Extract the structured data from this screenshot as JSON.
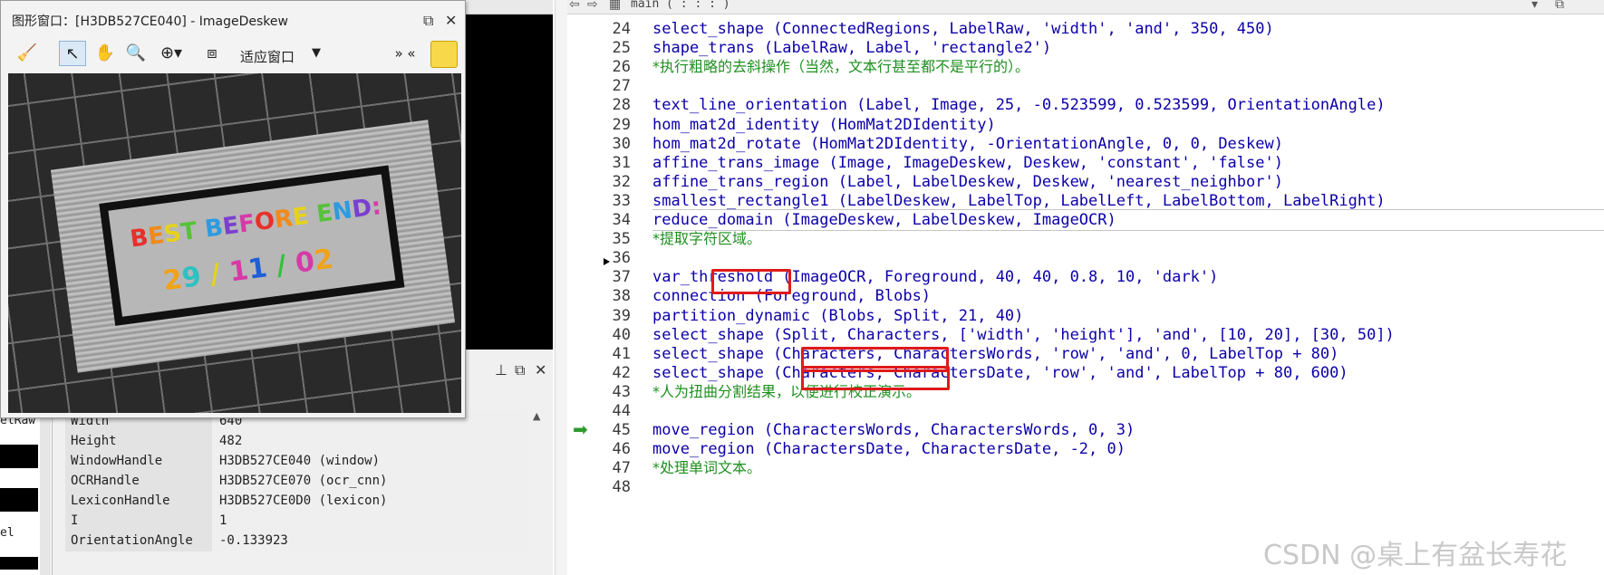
{
  "graphics_window": {
    "title": "图形窗口：[H3DB527CE040] - ImageDeskew",
    "fit_label": "适应窗口",
    "overflow_label": "» «"
  },
  "image": {
    "headline": "BEST BEFORE END:",
    "date_line": "29 / 11 / 02",
    "headline_colors": [
      "#e8302a",
      "#f08a1a",
      "#e6d21c",
      "#56c23a",
      "#2c9be0",
      "#7a3fd0",
      "#d63aa8"
    ],
    "date_colors": [
      "#f0a21a",
      "#2fc1c1",
      "#e8d21c",
      "#d63aa8",
      "#1e5ed6",
      "#2ec43a",
      "#d63aa8"
    ]
  },
  "object_strip": {
    "labels": [
      "elRaw",
      "el"
    ]
  },
  "properties": [
    {
      "key": "Width",
      "value": "640"
    },
    {
      "key": "Height",
      "value": "482"
    },
    {
      "key": "WindowHandle",
      "value": "H3DB527CE040 (window)"
    },
    {
      "key": "OCRHandle",
      "value": "H3DB527CE070 (ocr_cnn)"
    },
    {
      "key": "LexiconHandle",
      "value": "H3DB527CE0D0 (lexicon)"
    },
    {
      "key": "I",
      "value": "1"
    },
    {
      "key": "OrientationAngle",
      "value": "-0.133923"
    }
  ],
  "editor": {
    "procedure_selector": "main ( : : : )",
    "current_line": "45",
    "lines": [
      {
        "n": "24",
        "code": "select_shape (ConnectedRegions, LabelRaw, 'width', 'and', 350, 450)",
        "comment": false
      },
      {
        "n": "25",
        "code": "shape_trans (LabelRaw, Label, 'rectangle2')",
        "comment": false
      },
      {
        "n": "26",
        "code": "*执行粗略的去斜操作（当然，文本行甚至都不是平行的）。",
        "comment": true
      },
      {
        "n": "27",
        "code": "",
        "comment": false
      },
      {
        "n": "28",
        "code": "text_line_orientation (Label, Image, 25, -0.523599, 0.523599, OrientationAngle)",
        "comment": false
      },
      {
        "n": "29",
        "code": "hom_mat2d_identity (HomMat2DIdentity)",
        "comment": false
      },
      {
        "n": "30",
        "code": "hom_mat2d_rotate (HomMat2DIdentity, -OrientationAngle, 0, 0, Deskew)",
        "comment": false
      },
      {
        "n": "31",
        "code": "affine_trans_image (Image, ImageDeskew, Deskew, 'constant', 'false')",
        "comment": false
      },
      {
        "n": "32",
        "code": "affine_trans_region (Label, LabelDeskew, Deskew, 'nearest_neighbor')",
        "comment": false
      },
      {
        "n": "33",
        "code": "smallest_rectangle1 (LabelDeskew, LabelTop, LabelLeft, LabelBottom, LabelRight)",
        "comment": false
      },
      {
        "n": "34",
        "code": "reduce_domain (ImageDeskew, LabelDeskew, ImageOCR)",
        "comment": false
      },
      {
        "n": "35",
        "code": "*提取字符区域。",
        "comment": true
      },
      {
        "n": "36",
        "code": "",
        "comment": false
      },
      {
        "n": "37",
        "code": "var_threshold (ImageOCR, Foreground, 40, 40, 0.8, 10, 'dark')",
        "comment": false
      },
      {
        "n": "38",
        "code": "connection (Foreground, Blobs)",
        "comment": false
      },
      {
        "n": "39",
        "code": "partition_dynamic (Blobs, Split, 21, 40)",
        "comment": false
      },
      {
        "n": "40",
        "code": "select_shape (Split, Characters, ['width', 'height'], 'and', [10, 20], [30, 50])",
        "comment": false
      },
      {
        "n": "41",
        "code": "select_shape (Characters, CharactersWords, 'row', 'and', 0, LabelTop + 80)",
        "comment": false
      },
      {
        "n": "42",
        "code": "select_shape (Characters, CharactersDate, 'row', 'and', LabelTop + 80, 600)",
        "comment": false
      },
      {
        "n": "43",
        "code": "*人为扭曲分割结果，以便进行校正演示。",
        "comment": true
      },
      {
        "n": "44",
        "code": "",
        "comment": false
      },
      {
        "n": "45",
        "code": "move_region (CharactersWords, CharactersWords, 0, 3)",
        "comment": false
      },
      {
        "n": "46",
        "code": "move_region (CharactersDate, CharactersDate, -2, 0)",
        "comment": false
      },
      {
        "n": "47",
        "code": "*处理单词文本。",
        "comment": true
      },
      {
        "n": "48",
        "code": "",
        "comment": false
      }
    ]
  },
  "watermark": "CSDN @桌上有盆长寿花"
}
